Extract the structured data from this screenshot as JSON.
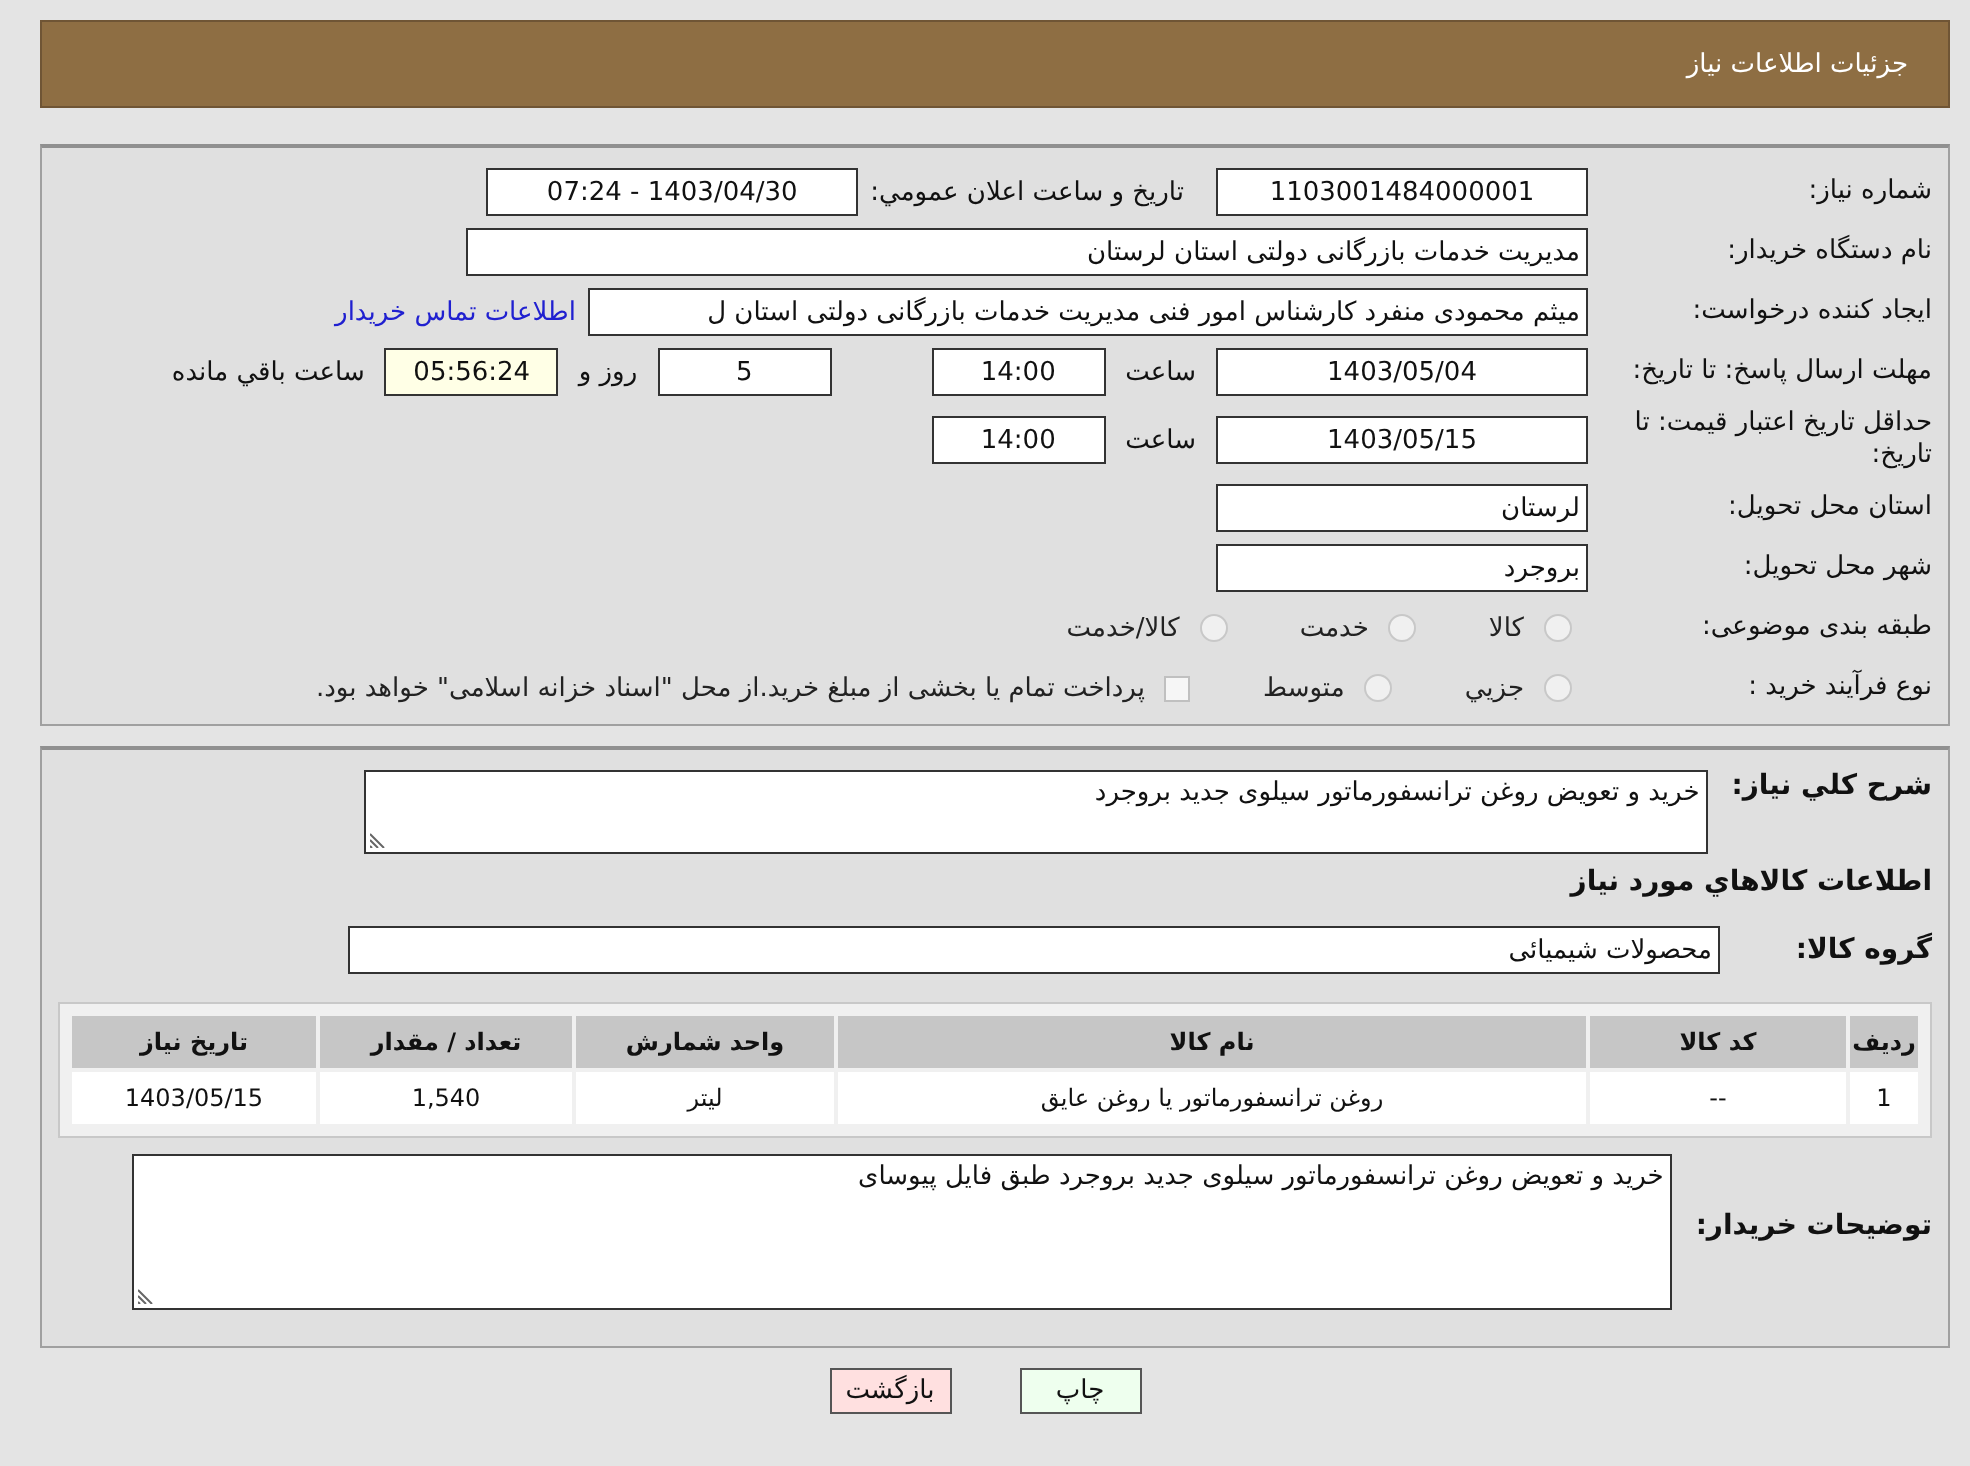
{
  "header": {
    "title": "جزئیات اطلاعات نیاز"
  },
  "need_number": {
    "label": "شماره نیاز:",
    "value": "1103001484000001"
  },
  "announce": {
    "label": "تاريخ و ساعت اعلان عمومي:",
    "value": "1403/04/30 - 07:24"
  },
  "buyer_org": {
    "label": "نام دستگاه خریدار:",
    "value": "مدیریت خدمات بازرگانی دولتی استان لرستان"
  },
  "requester": {
    "label": "ایجاد کننده درخواست:",
    "value": "میثم محمودی منفرد کارشناس امور فنی مدیریت خدمات بازرگانی دولتی استان ل",
    "link": "اطلاعات تماس خریدار"
  },
  "deadline": {
    "label": "مهلت ارسال پاسخ: تا تاریخ:",
    "date": "1403/05/04",
    "time_label": "ساعت",
    "time": "14:00",
    "days": "5",
    "days_label": "روز و",
    "remaining": "05:56:24",
    "remaining_label": "ساعت باقي مانده"
  },
  "validity": {
    "label": "حداقل تاریخ اعتبار قیمت: تا تاریخ:",
    "date": "1403/05/15",
    "time_label": "ساعت",
    "time": "14:00"
  },
  "province": {
    "label": "استان محل تحویل:",
    "value": "لرستان"
  },
  "city": {
    "label": "شهر محل تحویل:",
    "value": "بروجرد"
  },
  "category": {
    "label": "طبقه بندی موضوعی:",
    "options": [
      {
        "label": "كالا",
        "selected": false
      },
      {
        "label": "خدمت",
        "selected": false
      },
      {
        "label": "كالا/خدمت",
        "selected": false
      }
    ]
  },
  "purchase_type": {
    "label": "نوع فرآیند خرید :",
    "options": [
      {
        "label": "جزيي",
        "selected": false
      },
      {
        "label": "متوسط",
        "selected": false
      }
    ],
    "treasury": {
      "label": "پرداخت تمام یا بخشی از مبلغ خرید.از محل \"اسناد خزانه اسلامی\" خواهد بود.",
      "checked": false
    }
  },
  "summary": {
    "label": "شرح كلي نياز:",
    "value": "خرید و تعویض روغن ترانسفورماتور سیلوی جدید بروجرد"
  },
  "goods_heading": "اطلاعات كالاهاي مورد نياز",
  "group": {
    "label": "گروه كالا:",
    "value": "محصولات شیمیائی"
  },
  "table": {
    "columns": [
      "ردیف",
      "کد کالا",
      "نام کالا",
      "واحد شمارش",
      "تعداد / مقدار",
      "تاریخ نیاز"
    ],
    "rows": [
      [
        "1",
        "--",
        "روغن ترانسفورماتور یا روغن عایق",
        "لیتر",
        "1,540",
        "1403/05/15"
      ]
    ]
  },
  "buyer_notes": {
    "label": "توضیحات خریدار:",
    "value": "خرید و تعویض روغن ترانسفورماتور سیلوی جدید بروجرد طبق فایل پیوسای"
  },
  "buttons": [
    {
      "label": "چاپ",
      "kind": "print"
    },
    {
      "label": "بازگشت",
      "kind": "back"
    }
  ]
}
